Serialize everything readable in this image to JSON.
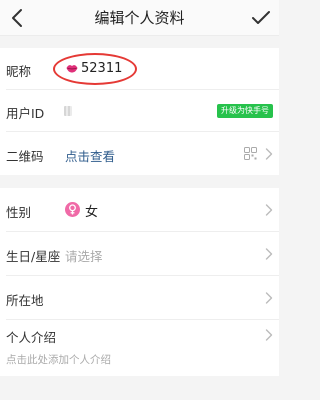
{
  "nav": {
    "title": "编辑个人资料",
    "back_icon": "chevron-left-icon",
    "done_icon": "checkmark-icon"
  },
  "profile": {
    "nickname": {
      "label": "昵称",
      "value": "52311",
      "icon": "lips-icon",
      "highlight_color": "#e53935"
    },
    "user_id": {
      "label": "用户ID",
      "upgrade_label": "升级为快手号",
      "upgrade_color": "#27c24c"
    },
    "qr_code": {
      "label": "二维码",
      "link_text": "点击查看",
      "link_color": "#2f5c8c",
      "icon": "qr-code-icon"
    },
    "gender": {
      "label": "性别",
      "value": "女",
      "icon": "female-icon",
      "icon_color": "#f06aa7"
    },
    "birthday": {
      "label": "生日/星座",
      "placeholder": "请选择"
    },
    "location": {
      "label": "所在地"
    },
    "bio": {
      "label": "个人介绍",
      "placeholder": "点击此处添加个人介绍"
    }
  }
}
